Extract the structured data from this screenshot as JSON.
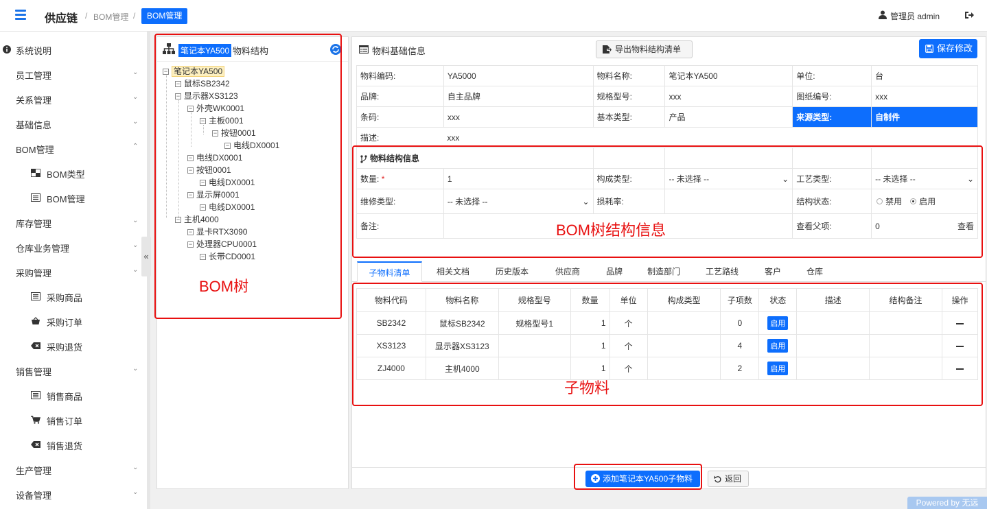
{
  "header": {
    "brand": "供应链",
    "sep": "/",
    "crumb1": "BOM管理",
    "crumb2": "BOM管理",
    "user": "管理员  admin",
    "accent": "#0d6efd"
  },
  "sidebar": {
    "items": [
      {
        "label": "系统说明"
      },
      {
        "label": "员工管理"
      },
      {
        "label": "关系管理"
      },
      {
        "label": "基础信息"
      },
      {
        "label": "BOM管理"
      },
      {
        "label": "BOM类型"
      },
      {
        "label": "BOM管理"
      },
      {
        "label": "库存管理"
      },
      {
        "label": "仓库业务管理"
      },
      {
        "label": "采购管理"
      },
      {
        "label": "采购商品"
      },
      {
        "label": "采购订单"
      },
      {
        "label": "采购退货"
      },
      {
        "label": "销售管理"
      },
      {
        "label": "销售商品"
      },
      {
        "label": "销售订单"
      },
      {
        "label": "销售退货"
      },
      {
        "label": "生产管理"
      },
      {
        "label": "设备管理"
      }
    ],
    "collapse": "«"
  },
  "tree": {
    "title_highlight": "笔记本YA500",
    "title_suffix": "物料结构",
    "nodes": [
      "笔记本YA500",
      "鼠标SB2342",
      "显示器XS3123",
      "外壳WK0001",
      "主板0001",
      "按钮0001",
      "电线DX0001",
      "电线DX0001",
      "按钮0001",
      "电线DX0001",
      "显示屏0001",
      "电线DX0001",
      "主机4000",
      "显卡RTX3090",
      "处理器CPU0001",
      "长带CD0001"
    ]
  },
  "main": {
    "title": "物料基础信息",
    "export": "导出物料结构清单",
    "save": "保存修改",
    "basic": {
      "code_l": "物料编码:",
      "code_v": "YA5000",
      "name_l": "物料名称:",
      "name_v": "笔记本YA500",
      "unit_l": "单位:",
      "unit_v": "台",
      "brand_l": "品牌:",
      "brand_v": "自主品牌",
      "spec_l": "规格型号:",
      "spec_v": "xxx",
      "draw_l": "图纸编号:",
      "draw_v": "xxx",
      "bar_l": "条码:",
      "bar_v": "xxx",
      "type_l": "基本类型:",
      "type_v": "产品",
      "src_l": "来源类型:",
      "src_v": "自制件",
      "desc_l": "描述:",
      "desc_v": "xxx"
    },
    "struct": {
      "title": "物料结构信息",
      "qty_l": "数量:",
      "req": "*",
      "qty_v": "1",
      "comp_l": "构成类型:",
      "comp_v": "-- 未选择 --",
      "proc_l": "工艺类型:",
      "proc_v": "-- 未选择 --",
      "rep_l": "维修类型:",
      "rep_v": "-- 未选择 --",
      "loss_l": "损耗率:",
      "stat_l": "结构状态:",
      "off": "禁用",
      "on": "启用",
      "note_l": "备注:",
      "parent_l": "查看父项:",
      "parent_v": "0",
      "view": "查看"
    },
    "tabs": [
      "子物料清单",
      "相关文档",
      "历史版本",
      "供应商",
      "品牌",
      "制造部门",
      "工艺路线",
      "客户",
      "仓库"
    ],
    "sub": {
      "headers": [
        "物料代码",
        "物料名称",
        "规格型号",
        "数量",
        "单位",
        "构成类型",
        "子项数",
        "状态",
        "描述",
        "结构备注",
        "操作"
      ],
      "rows": [
        {
          "code": "SB2342",
          "name": "鼠标SB2342",
          "spec": "规格型号1",
          "qty": "1",
          "unit": "个",
          "comp": "",
          "count": "0",
          "status": "启用",
          "desc": "",
          "note": ""
        },
        {
          "code": "XS3123",
          "name": "显示器XS3123",
          "spec": "",
          "qty": "1",
          "unit": "个",
          "comp": "",
          "count": "4",
          "status": "启用",
          "desc": "",
          "note": ""
        },
        {
          "code": "ZJ4000",
          "name": "主机4000",
          "spec": "",
          "qty": "1",
          "unit": "个",
          "comp": "",
          "count": "2",
          "status": "启用",
          "desc": "",
          "note": ""
        }
      ]
    },
    "add": "添加笔记本YA500子物料",
    "back": "返回"
  },
  "annotations": {
    "tree": "BOM树",
    "struct": "BOM树结构信息",
    "sub": "子物料",
    "color": "#e81010"
  },
  "powered": "Powered by 无远"
}
